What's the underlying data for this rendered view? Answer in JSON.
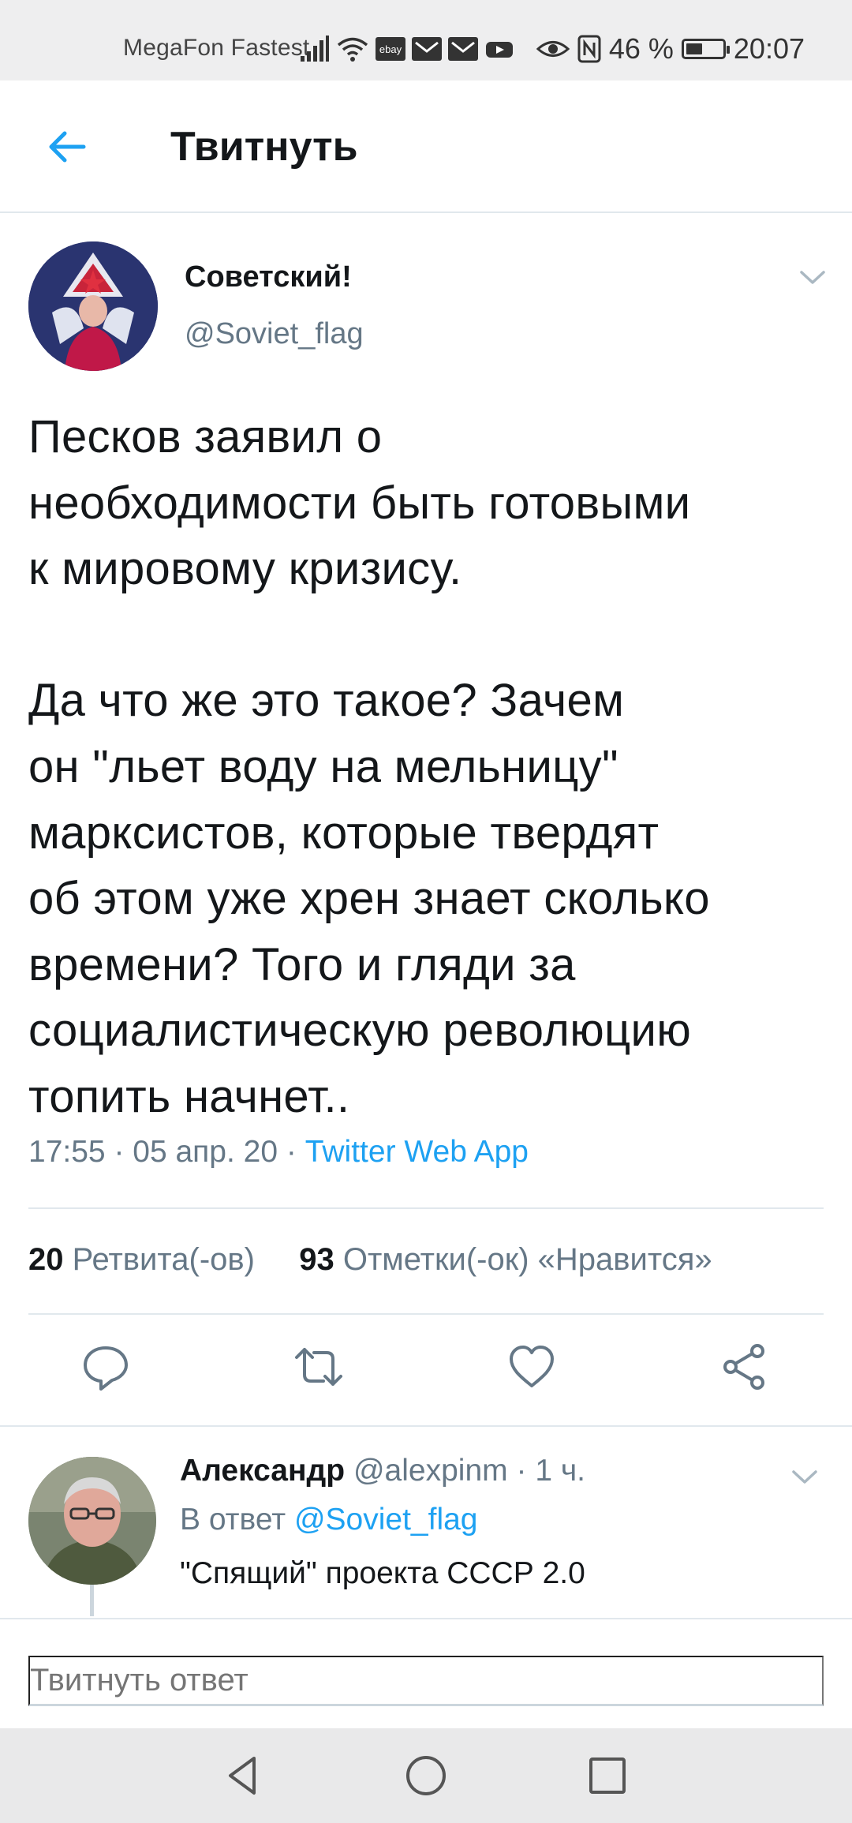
{
  "status_bar": {
    "carrier": "MegaFon Fastest",
    "battery_percent": "46 %",
    "battery_level": 0.46,
    "time": "20:07",
    "app_notification_icons": [
      "ebay-icon",
      "mail-icon",
      "mail-icon",
      "youtube-icon"
    ]
  },
  "header": {
    "title": "Твитнуть"
  },
  "tweet": {
    "author_name": "Советский!",
    "author_handle": "@Soviet_flag",
    "text": "Песков заявил о\nнеобходимости быть готовыми\nк мировому кризису.\n\nДа что же это такое? Зачем\nон \"льет воду на мельницу\"\nмарксистов, которые твердят\nоб этом уже хрен знает сколько\nвремени? Того и гляди за\nсоциалистическую революцию\nтопить начнет..",
    "time": "17:55",
    "date": "05 апр. 20",
    "source": "Twitter Web App",
    "retweets_count": "20",
    "retweets_label": "Ретвита(-ов)",
    "likes_count": "93",
    "likes_label": "Отметки(-ок) «Нравится»"
  },
  "reply": {
    "author_name": "Александр",
    "author_handle": "@alexpinm",
    "time_ago": "1 ч.",
    "reply_to_prefix": "В ответ",
    "reply_to_handle": "@Soviet_flag",
    "text": "\"Спящий\" проекта СССР 2.0"
  },
  "compose": {
    "placeholder": "Твитнуть ответ"
  },
  "colors": {
    "accent": "#1da1f2",
    "secondary_text": "#657786",
    "primary_text": "#14171a",
    "divider": "#e1e8ed",
    "status_bar_bg": "#eeeeef",
    "nav_bar_bg": "#e9e9ea"
  }
}
